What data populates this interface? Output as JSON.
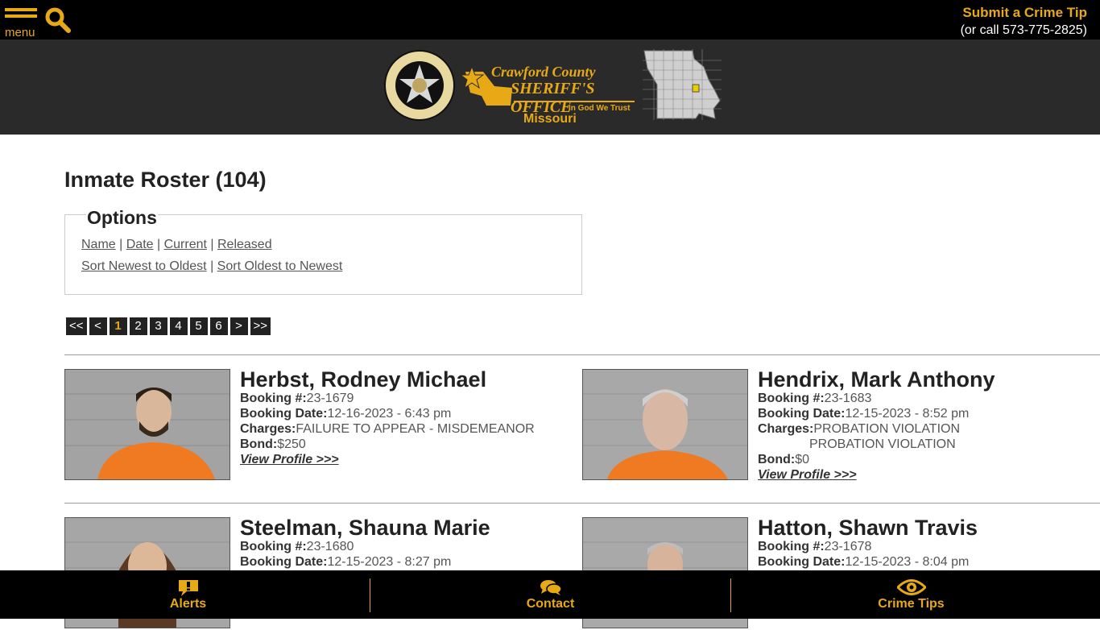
{
  "topbar": {
    "menu_label": "menu",
    "tip_title": "Submit a Crime Tip",
    "tip_phone": "(or call 573-775-2825)",
    "accent": "#e8a917"
  },
  "banner": {
    "agency_line1": "Crawford County",
    "agency_line2": "SHERIFF'S OFFICE",
    "motto": "In God We Trust",
    "state": "Missouri",
    "badge_icon": "sheriff-star-badge-icon",
    "map_icon": "missouri-county-map-icon"
  },
  "page": {
    "title": "Inmate Roster (104)"
  },
  "options": {
    "legend": "Options",
    "sort_by": [
      "Name",
      "Date",
      "Current",
      "Released"
    ],
    "sort_order": [
      "Sort Newest to Oldest",
      "Sort Oldest to Newest"
    ]
  },
  "pagination": [
    "<<",
    "<",
    "1",
    "2",
    "3",
    "4",
    "5",
    "6",
    ">",
    ">>"
  ],
  "pagination_active": "1",
  "labels": {
    "booking_no": "Booking #:",
    "booking_date": "Booking Date:",
    "charges": "Charges:",
    "bond": "Bond:",
    "view_profile": "View Profile >>>"
  },
  "inmates": [
    {
      "name": "Herbst, Rodney Michael",
      "booking_no": "23-1679",
      "booking_date": "12-16-2023 - 6:43 pm",
      "charges": [
        "FAILURE TO APPEAR - MISDEMEANOR"
      ],
      "bond": "$250"
    },
    {
      "name": "Hendrix, Mark Anthony",
      "booking_no": "23-1683",
      "booking_date": "12-15-2023 - 8:52 pm",
      "charges": [
        "PROBATION VIOLATION",
        "PROBATION VIOLATION"
      ],
      "bond": "$0"
    },
    {
      "name": "Steelman, Shauna Marie",
      "booking_no": "23-1680",
      "booking_date": "12-15-2023 - 8:27 pm"
    },
    {
      "name": "Hatton, Shawn Travis",
      "booking_no": "23-1678",
      "booking_date": "12-15-2023 - 8:04 pm"
    }
  ],
  "footer": {
    "alerts": "Alerts",
    "contact": "Contact",
    "crime_tips": "Crime Tips"
  }
}
